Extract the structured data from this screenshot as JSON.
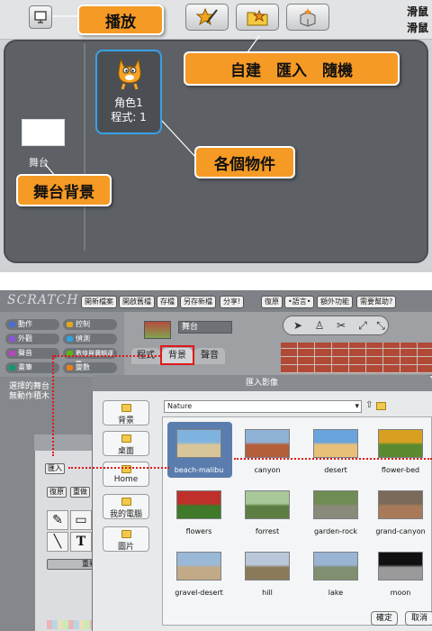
{
  "top": {
    "mouse_labels": [
      "滑鼠",
      "滑鼠"
    ],
    "stage_label": "舞台",
    "sprite": {
      "name": "角色1",
      "scripts": "程式: 1"
    }
  },
  "callouts": {
    "present": "播放",
    "new_sprite": "自建　匯入　隨機",
    "objects": "各個物件",
    "stage_bg": "舞台背景"
  },
  "scratch": {
    "logo": "SCRATCH",
    "menu": [
      "開新檔案",
      "開啟舊檔",
      "存檔",
      "另存新檔",
      "分享!",
      "復原",
      "•語言•",
      "額外功能",
      "需要幫助?"
    ],
    "categories": [
      {
        "label": "動作",
        "color": "#4a6cd4"
      },
      {
        "label": "控制",
        "color": "#e1a91a"
      },
      {
        "label": "外觀",
        "color": "#8a55d7"
      },
      {
        "label": "偵測",
        "color": "#2ca5e2"
      },
      {
        "label": "聲音",
        "color": "#bb42c3"
      },
      {
        "label": "數值與邏輯運算",
        "color": "#5cb712"
      },
      {
        "label": "畫筆",
        "color": "#0e9a6c"
      },
      {
        "label": "變數",
        "color": "#ee7d16"
      }
    ],
    "palette_msg": [
      "選擇的舞台",
      "無動作積木"
    ],
    "stage_name": "舞台",
    "tabs": [
      "程式",
      "背景",
      "聲音"
    ]
  },
  "paint": {
    "import_btn": "匯入",
    "undo": "復原",
    "redo": "重做",
    "clear": "重新"
  },
  "dialog": {
    "title": "匯入影像",
    "path": "Nature",
    "sidebar": [
      "背景",
      "桌面",
      "Home",
      "我的電腦",
      "圖片"
    ],
    "images": [
      {
        "name": "beach-malibu",
        "c1": "#7fb3df",
        "c2": "#d8c59a"
      },
      {
        "name": "canyon",
        "c1": "#8fb2d6",
        "c2": "#b45e3a"
      },
      {
        "name": "desert",
        "c1": "#6aa4dc",
        "c2": "#e8c07a"
      },
      {
        "name": "flower-bed",
        "c1": "#d8a020",
        "c2": "#5a8a30"
      },
      {
        "name": "flowers",
        "c1": "#c0302a",
        "c2": "#3f7a2a"
      },
      {
        "name": "forrest",
        "c1": "#a9c89a",
        "c2": "#5d7e42"
      },
      {
        "name": "garden-rock",
        "c1": "#6e8c54",
        "c2": "#8a8a7a"
      },
      {
        "name": "grand-canyon",
        "c1": "#7a6a5a",
        "c2": "#a87a5a"
      },
      {
        "name": "gravel-desert",
        "c1": "#9ab8d8",
        "c2": "#c2aa88"
      },
      {
        "name": "hill",
        "c1": "#b8c8d8",
        "c2": "#8a7a5a"
      },
      {
        "name": "lake",
        "c1": "#9ab4d4",
        "c2": "#7f8f70"
      },
      {
        "name": "moon",
        "c1": "#111111",
        "c2": "#9a9a9a"
      }
    ],
    "ok": "確定",
    "cancel": "取消"
  }
}
